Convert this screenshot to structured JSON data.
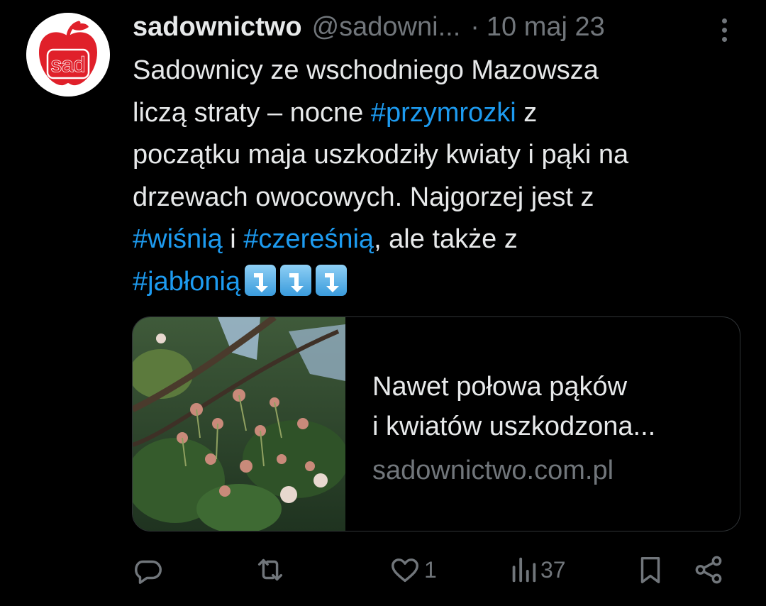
{
  "tweet": {
    "author": {
      "name": "sadownictwo",
      "handle": "@sadowni...",
      "avatar_text": "sad",
      "avatar_color": "#e0202a"
    },
    "separator": "·",
    "date": "10 maj 23",
    "text": {
      "line1": "Sadownicy ze wschodniego Mazowsza",
      "line2_pre": "liczą straty – nocne ",
      "tag_przymrozki": "#przymrozki",
      "line2_post": " z",
      "line3": "początku maja uszkodziły kwiaty i pąki na",
      "line4": "drzewach owocowych. Najgorzej jest z",
      "tag_wisnia": "#wiśnią",
      "line5_mid": " i ",
      "tag_czeresnia": "#czereśnią",
      "line5_post": ", ale także z",
      "tag_jablonia": "#jabłonią",
      "emojis": [
        "arrow-down-emoji",
        "arrow-down-emoji",
        "arrow-down-emoji"
      ]
    },
    "link_card": {
      "title_line1": "Nawet połowa pąków",
      "title_line2": "i kwiatów uszkodzona...",
      "domain": "sadownictwo.com.pl"
    },
    "actions": {
      "reply_count": "",
      "retweet_count": "",
      "like_count": "1",
      "views_count": "37"
    },
    "colors": {
      "background": "#000000",
      "text": "#e7e9ea",
      "muted": "#71767b",
      "accent": "#1d9bf0",
      "border": "#2f3336"
    }
  }
}
